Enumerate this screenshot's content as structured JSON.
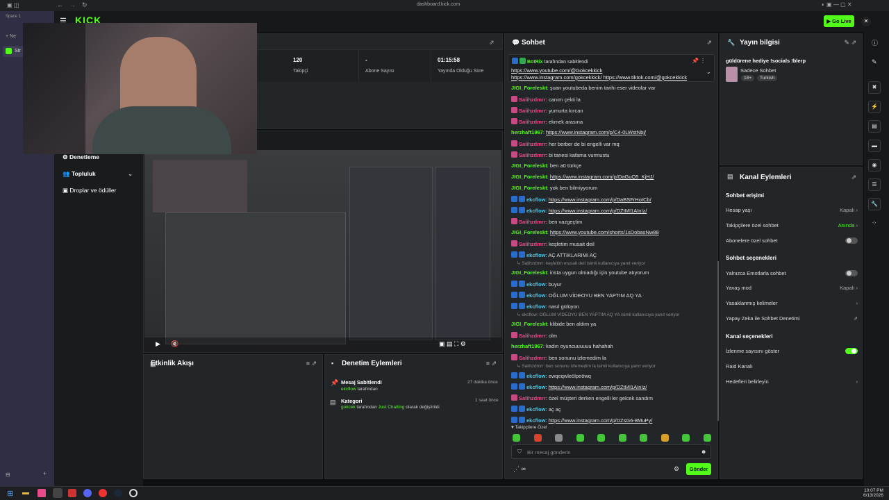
{
  "browser": {
    "url": "dashboard.kick.com",
    "space": "Space 1",
    "tab_partial": "Str",
    "new_partial": "Ne"
  },
  "header": {
    "go_live": "Go Live",
    "brand": "KICK"
  },
  "stats": [
    {
      "value": "120",
      "label": "Takipçi"
    },
    {
      "value": "-",
      "label": "Abone Sayısı"
    },
    {
      "value": "01:15:58",
      "label": "Yayında Olduğu Süre"
    }
  ],
  "nav": {
    "items": [
      "Denetleme",
      "Topluluk",
      "Droplar ve ödüller"
    ]
  },
  "activity": {
    "title": "Etkinlik Akışı"
  },
  "moderation": {
    "title": "Denetim Eylemleri",
    "items": [
      {
        "title": "Mesaj Sabitlendi",
        "user": "ekcflow",
        "suffix": "tarafından",
        "time": "27 dakika önce"
      },
      {
        "title": "Kategori",
        "user": "gokcek",
        "mid": "tarafından",
        "category": "Just Chatting",
        "tail": "olarak değiştirildi",
        "time": "1 saat önce"
      }
    ]
  },
  "chat": {
    "title": "Sohbet",
    "pinned": {
      "by": "BotRix",
      "by_suffix": "tarafından sabitlendi",
      "line1": "https://www.youtube.com/@Gokcekkick",
      "line2a": "https://www.instagram.com/gokcekkick/",
      "line2b": "https://www.tiktok.com/@gokcekkick"
    },
    "messages": [
      {
        "user": "JIGI_Foreleskt",
        "color": "green",
        "text": "şuan youtubeda benim tarihi eser videolar var"
      },
      {
        "user": "Salihzdmrr",
        "color": "pink",
        "text": "canım çekti la"
      },
      {
        "user": "Salihzdmrr",
        "color": "pink",
        "text": "yumurta kırcan"
      },
      {
        "user": "Salihzdmrr",
        "color": "pink",
        "text": "ekmek arasına"
      },
      {
        "user": "herzhaft1967",
        "color": "green",
        "link": "https://www.instagram.com/p/C4-0LWstNbj/"
      },
      {
        "user": "Salihzdmrr",
        "color": "pink",
        "text": "her berber de bi engelli var mq"
      },
      {
        "user": "Salihzdmrr",
        "color": "pink",
        "text": "bi tanesi kafama vurmustu"
      },
      {
        "user": "JIGI_Foreleskt",
        "color": "green",
        "text": "ben a0 türkçe"
      },
      {
        "user": "JIGI_Foreleskt",
        "color": "green",
        "link": "https://www.instagram.com/p/DaGuQ5_KjHJ/"
      },
      {
        "user": "JIGI_Foreleskt",
        "color": "green",
        "text": "yok ben bilmiyyorum"
      },
      {
        "user": "ekcflow",
        "color": "cyan",
        "link": "https://www.instagram.com/p/DaBSFrHotCb/"
      },
      {
        "user": "ekcflow",
        "color": "cyan",
        "link": "https://www.instagram.com/p/DZtMI1AInIz/"
      },
      {
        "user": "Salihzdmrr",
        "color": "pink",
        "text": "ben vazgeçtim"
      },
      {
        "user": "JIGI_Foreleskt",
        "color": "green",
        "link": "https://www.youtube.com/shorts/1sDobasNw88"
      },
      {
        "user": "Salihzdmrr",
        "color": "pink",
        "text": "keşfetim musait deil"
      },
      {
        "user": "ekcflow",
        "color": "cyan",
        "text": "AÇ ATTIKLARIMI AÇ"
      },
      {
        "reply": "Salihzdmrr: keşfetim musait deil isimli kullanıcıya yanıt veriyor"
      },
      {
        "user": "JIGI_Foreleskt",
        "color": "green",
        "text": "insta uygun olmadığı için youtube atıyorum"
      },
      {
        "user": "ekcflow",
        "color": "cyan",
        "text": "buyur"
      },
      {
        "user": "ekcflow",
        "color": "cyan",
        "text": "OĞLUM VİDEOYU BEN YAPTIM AQ YA"
      },
      {
        "user": "ekcflow",
        "color": "cyan",
        "text": "nasıl gülüyon"
      },
      {
        "reply": "ekcflow: OĞLUM VİDEOYU BEN YAPTIM AQ YA isimli kullanıcıya yanıt veriyor"
      },
      {
        "user": "JIGI_Foreleskt",
        "color": "green",
        "text": "klibide ben aldım ya"
      },
      {
        "user": "Salihzdmrr",
        "color": "pink",
        "text": "olm"
      },
      {
        "user": "herzhaft1967",
        "color": "green",
        "text": "kadın oyuncuuuuuu hahahah"
      },
      {
        "user": "Salihzdmrr",
        "color": "pink",
        "text": "ben sonunu izlemedim la"
      },
      {
        "reply": "Salihzdmrr: ben sonunu izlemedim la isimli kullanıcıya yanıt veriyor"
      },
      {
        "user": "ekcflow",
        "color": "cyan",
        "text": "ewqeqwleölpeöwq"
      },
      {
        "user": "ekcflow",
        "color": "cyan",
        "link": "https://www.instagram.com/p/DZtMI1AInIz/"
      },
      {
        "user": "Salihzdmrr",
        "color": "pink",
        "text": "özel müşteri derken engelli ler gelcek sandım"
      },
      {
        "user": "ekcflow",
        "color": "cyan",
        "text": "aç aç"
      },
      {
        "user": "ekcflow",
        "color": "cyan",
        "link": "https://www.instagram.com/p/DZsG6-8MuPy/"
      }
    ],
    "followers_only": "Takipçilere Özel",
    "input_placeholder": "Bir mesaj gönderin",
    "send": "Gönder",
    "infinity": "∞"
  },
  "stream_info": {
    "title": "Yayın bilgisi",
    "stream_title": "güldürene hediye !socials !blerp",
    "category": "Sadece Sohbet",
    "tags": [
      "18+",
      "Turkish"
    ]
  },
  "channel_actions": {
    "title": "Kanal Eylemleri",
    "chat_access": {
      "title": "Sohbet erişimi",
      "rows": [
        {
          "label": "Hesap yaşı",
          "value": "Kapalı"
        },
        {
          "label": "Takipçilere özel sohbet",
          "value": "Anında"
        },
        {
          "label": "Abonelere özel sohbet",
          "toggle": false
        }
      ]
    },
    "chat_options": {
      "title": "Sohbet seçenekleri",
      "rows": [
        {
          "label": "Yalnızca Emotlarla sohbet",
          "toggle": false
        },
        {
          "label": "Yavaş mod",
          "value": "Kapalı"
        },
        {
          "label": "Yasaklanmış kelimeler"
        },
        {
          "label": "Yapay Zeka ile Sohbet Denetimi"
        }
      ]
    },
    "channel_options": {
      "title": "Kanal seçenekleri",
      "rows": [
        {
          "label": "İzlenme sayısını göster",
          "toggle": true
        },
        {
          "label": "Raid Kanalı"
        },
        {
          "label": "Hedefleri belirleyin"
        }
      ]
    }
  },
  "taskbar": {
    "time": "10:07 PM",
    "date": "6/13/2026"
  }
}
